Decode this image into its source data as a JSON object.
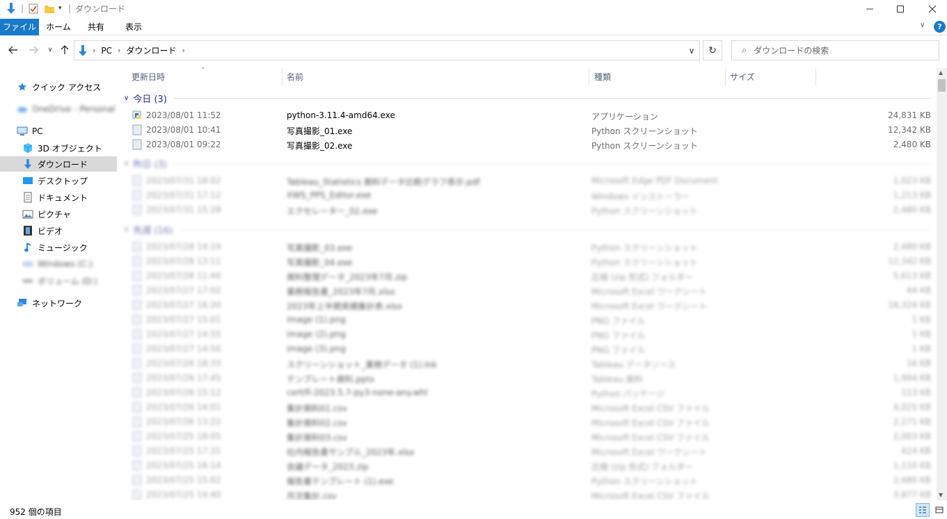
{
  "window": {
    "title": "ダウンロード",
    "controls": [
      "minimize",
      "maximize",
      "close"
    ]
  },
  "ribbon": {
    "tabs": [
      "ファイル",
      "ホーム",
      "共有",
      "表示"
    ]
  },
  "address": {
    "crumbs": [
      "PC",
      "ダウンロード"
    ],
    "search_placeholder": "ダウンロードの検索"
  },
  "navpane": {
    "quick_access": "クイック アクセス",
    "blurred_item_1": "OneDrive - Personal",
    "pc": "PC",
    "items": [
      "3D オブジェクト",
      "ダウンロード",
      "デスクトップ",
      "ドキュメント",
      "ピクチャ",
      "ビデオ",
      "ミュージック"
    ],
    "blurred_item_2": "Windows (C:)",
    "blurred_item_3": "ボリューム (D:)",
    "network": "ネットワーク"
  },
  "columns": {
    "date": "更新日時",
    "name": "名前",
    "type": "種類",
    "size": "サイズ"
  },
  "groups": {
    "today": "今日 (3)",
    "g2": "昨日 (3)",
    "g3": "先週 (16)"
  },
  "files_today": [
    {
      "date": "2023/08/01 11:52",
      "name": "python-3.11.4-amd64.exe",
      "type": "アプリケーション",
      "size": "24,831 KB"
    },
    {
      "date": "2023/08/01 10:41",
      "name": "写真撮影_01.exe",
      "type": "Python スクリーンショット",
      "size": "12,342 KB"
    },
    {
      "date": "2023/08/01 09:22",
      "name": "写真撮影_02.exe",
      "type": "Python スクリーンショット",
      "size": "2,480 KB"
    }
  ],
  "files_g2": [
    {
      "date": "2023/07/31 18:02",
      "name": "Tableau_Statistics 資料データ比較グラフ表示.pdf",
      "type": "Microsoft Edge PDF Document",
      "size": "1,023 KB"
    },
    {
      "date": "2023/07/31 17:12",
      "name": "XWS_PPS_Editor.exe",
      "type": "Windows インストーラー",
      "size": "1,213 KB"
    },
    {
      "date": "2023/07/31 15:28",
      "name": "エクセレーター_02.exe",
      "type": "Python スクリーンショット",
      "size": "2,480 KB"
    }
  ],
  "files_g3": [
    {
      "date": "2023/07/28 14:19",
      "name": "写真撮影_03.exe",
      "type": "Python スクリーンショット",
      "size": "2,480 KB"
    },
    {
      "date": "2023/07/28 13:11",
      "name": "写真撮影_04.exe",
      "type": "Python スクリーンショット",
      "size": "12,342 KB"
    },
    {
      "date": "2023/07/28 11:40",
      "name": "資料整理データ_2023年7月.zip",
      "type": "圧縮 (zip 形式) フォルダー",
      "size": "5,613 KB"
    },
    {
      "date": "2023/07/27 17:02",
      "name": "業務報告書_2023年7月.xlsx",
      "type": "Microsoft Excel ワークシート",
      "size": "44 KB"
    },
    {
      "date": "2023/07/27 16:20",
      "name": "2023年上半期実績集計表.xlsx",
      "type": "Microsoft Excel ワークシート",
      "size": "18,324 KB"
    },
    {
      "date": "2023/07/27 15:01",
      "name": "image (1).png",
      "type": "PNG ファイル",
      "size": "1 KB"
    },
    {
      "date": "2023/07/27 14:55",
      "name": "image (2).png",
      "type": "PNG ファイル",
      "size": "1 KB"
    },
    {
      "date": "2023/07/27 14:50",
      "name": "image (3).png",
      "type": "PNG ファイル",
      "size": "1 KB"
    },
    {
      "date": "2023/07/26 18:33",
      "name": "スクリーンショット_業務データ (1).lnk",
      "type": "Tableau データソース",
      "size": "16 KB"
    },
    {
      "date": "2023/07/26 17:45",
      "name": "テンプレート資料.pptx",
      "type": "Tableau 資料",
      "size": "1,994 KB"
    },
    {
      "date": "2023/07/26 15:12",
      "name": "certifi-2023.5.7-py3-none-any.whl",
      "type": "Python パッケージ",
      "size": "113 KB"
    },
    {
      "date": "2023/07/26 14:01",
      "name": "集計資料01.csv",
      "type": "Microsoft Excel CSV ファイル",
      "size": "4,025 KB"
    },
    {
      "date": "2023/07/26 13:22",
      "name": "集計資料02.csv",
      "type": "Microsoft Excel CSV ファイル",
      "size": "2,271 KB"
    },
    {
      "date": "2023/07/25 18:05",
      "name": "集計資料03.csv",
      "type": "Microsoft Excel CSV ファイル",
      "size": "2,003 KB"
    },
    {
      "date": "2023/07/25 17:31",
      "name": "社内報告書サンプル_2023年.xlsx",
      "type": "Microsoft Excel ワークシート",
      "size": "424 KB"
    },
    {
      "date": "2023/07/25 16:14",
      "name": "会議データ_2023.zip",
      "type": "圧縮 (zip 形式) フォルダー",
      "size": "1,110 KB"
    },
    {
      "date": "2023/07/25 15:02",
      "name": "報告書テンプレート (1).exe",
      "type": "Python スクリーンショット",
      "size": "2,480 KB"
    },
    {
      "date": "2023/07/25 14:40",
      "name": "月次集計.csv",
      "type": "Microsoft Excel CSV ファイル",
      "size": "3,877 KB"
    }
  ],
  "status": {
    "count": "952 個の項目"
  },
  "colors": {
    "accent": "#1979ca",
    "group": "#1e3287",
    "header": "#4c607a"
  }
}
